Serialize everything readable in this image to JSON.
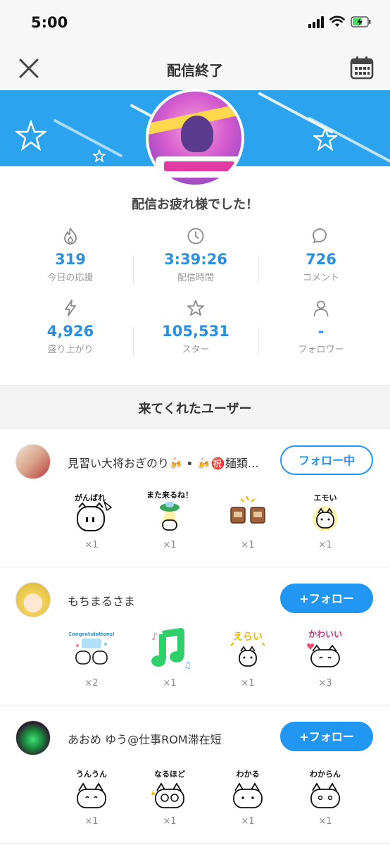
{
  "status_bar": {
    "time": "5:00"
  },
  "nav": {
    "title": "配信終了"
  },
  "thanks_message": "配信お疲れ様でした！",
  "stats": [
    {
      "value": "319",
      "label": "今日の応援",
      "icon": "flame-icon"
    },
    {
      "value": "3:39:26",
      "label": "配信時間",
      "icon": "clock-icon"
    },
    {
      "value": "726",
      "label": "コメント",
      "icon": "comment-icon"
    },
    {
      "value": "4,926",
      "label": "盛り上がり",
      "icon": "lightning-icon"
    },
    {
      "value": "105,531",
      "label": "スター",
      "icon": "star-icon"
    },
    {
      "value": "-",
      "label": "フォロワー",
      "icon": "person-icon"
    }
  ],
  "visitors_title": "来てくれたユーザー",
  "users": [
    {
      "name": "見習い大将おぎのり🍻▪️🍻㊗️麺類…",
      "button": "フォロー中",
      "stamps": [
        {
          "label": "がんばれ",
          "count": "×1"
        },
        {
          "label": "また来るね！",
          "count": "×1"
        },
        {
          "label": "",
          "count": "×1"
        },
        {
          "label": "エモい",
          "count": "×1"
        }
      ]
    },
    {
      "name": "もちまるさま",
      "button": "+フォロー",
      "stamps": [
        {
          "label": "Congratulations!",
          "count": "×2"
        },
        {
          "label": "",
          "count": "×1"
        },
        {
          "label": "えらい",
          "count": "×1"
        },
        {
          "label": "かわいい",
          "count": "×3"
        }
      ]
    },
    {
      "name": "あおめ ゆう@仕事ROM滞在短",
      "button": "+フォロー",
      "stamps": [
        {
          "label": "うんうん",
          "count": "×1"
        },
        {
          "label": "なるほど",
          "count": "×1"
        },
        {
          "label": "わかる",
          "count": "×1"
        },
        {
          "label": "わからん",
          "count": "×1"
        }
      ]
    }
  ],
  "colors": {
    "accent": "#2196f3",
    "banner": "#2ba3ef",
    "stat_value": "#2b8fe0"
  }
}
